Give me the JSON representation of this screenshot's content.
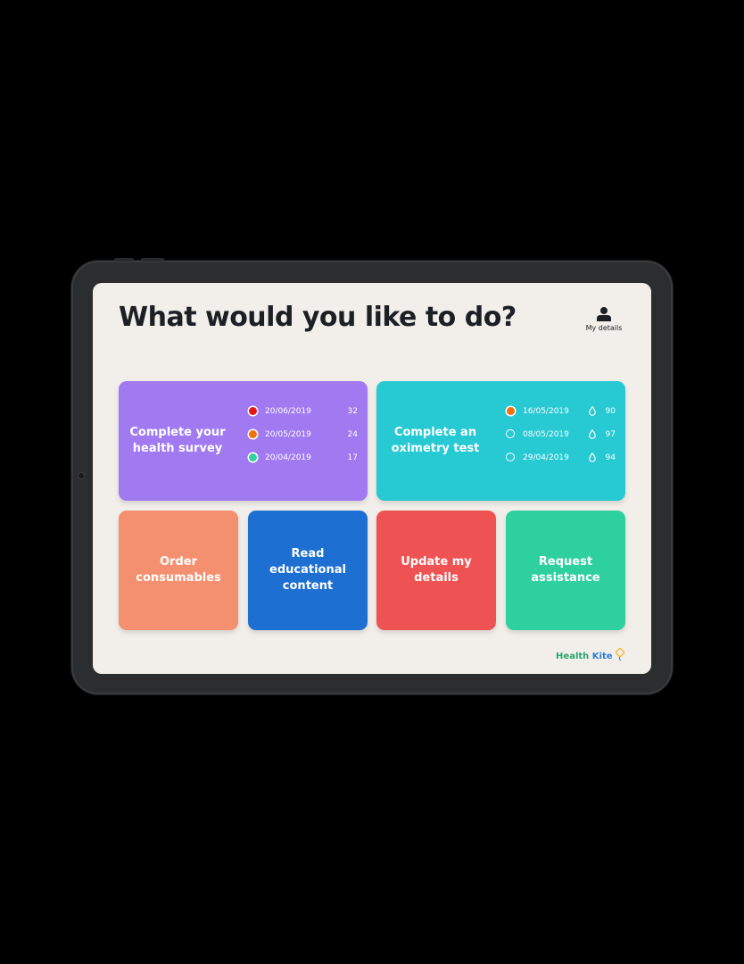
{
  "page": {
    "title": "What would you like to do?",
    "my_details_label": "My details"
  },
  "survey": {
    "label": "Complete your health survey",
    "color": "#a17af2",
    "entries": [
      {
        "date": "20/06/2019",
        "value": "32",
        "status": "red"
      },
      {
        "date": "20/05/2019",
        "value": "24",
        "status": "orange"
      },
      {
        "date": "20/04/2019",
        "value": "17",
        "status": "green"
      }
    ]
  },
  "oximetry": {
    "label": "Complete an oximetry test",
    "color": "#27c9d3",
    "entries": [
      {
        "date": "16/05/2019",
        "value": "90",
        "status": "orange"
      },
      {
        "date": "08/05/2019",
        "value": "97",
        "status": "green-outline"
      },
      {
        "date": "29/04/2019",
        "value": "94",
        "status": "green-outline"
      }
    ]
  },
  "actions": [
    {
      "label": "Order consumables",
      "color": "#f4906f"
    },
    {
      "label": "Read educational content",
      "color": "#1e6fd2"
    },
    {
      "label": "Update my details",
      "color": "#ee5252"
    },
    {
      "label": "Request assistance",
      "color": "#2fd0a0"
    }
  ],
  "status_colors": {
    "red": "#e3171a",
    "orange": "#f0720e",
    "green": "#2fd39b"
  },
  "logo": {
    "part1": "Health",
    "part2": "Kite",
    "icon": "kite-icon"
  }
}
